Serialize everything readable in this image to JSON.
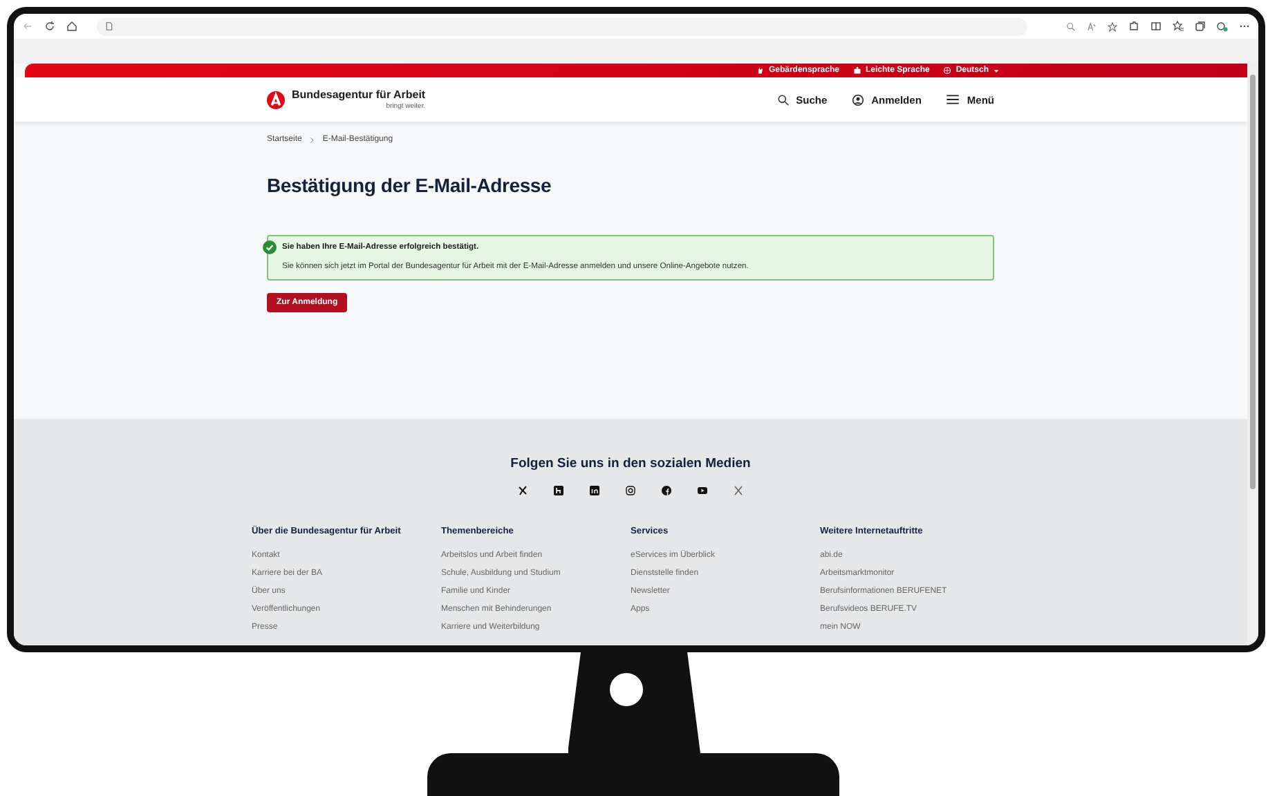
{
  "topbar": {
    "links": [
      {
        "label": "Gebärdensprache",
        "kind": "sign"
      },
      {
        "label": "Leichte Sprache",
        "kind": "easy"
      },
      {
        "label": "Deutsch",
        "kind": "language"
      }
    ]
  },
  "header": {
    "logo_name": "Bundesagentur für Arbeit",
    "logo_tagline": "bringt weiter.",
    "nav": [
      {
        "label": "Suche",
        "kind": "search"
      },
      {
        "label": "Anmelden",
        "kind": "account"
      },
      {
        "label": "Menü",
        "kind": "menu"
      }
    ]
  },
  "breadcrumb": [
    "Startseite",
    "E-Mail-Bestätigung"
  ],
  "title": "Bestätigung der E-Mail-Adresse",
  "alert": {
    "title": "Sie haben Ihre E-Mail-Adresse erfolgreich bestätigt.",
    "text": "Sie können sich jetzt im Portal der Bundesagentur für Arbeit mit der E-Mail-Adresse anmelden und unsere Online-Angebote nutzen."
  },
  "button": "Zur Anmeldung",
  "footer": {
    "social_heading": "Folgen Sie uns in den sozialen Medien",
    "columns": [
      {
        "heading": "Über die Bundesagentur für Arbeit",
        "links": [
          "Kontakt",
          "Karriere bei der BA",
          "Über uns",
          "Veröffentlichungen",
          "Presse"
        ]
      },
      {
        "heading": "Themenbereiche",
        "links": [
          "Arbeitslos und Arbeit finden",
          "Schule, Ausbildung und Studium",
          "Familie und Kinder",
          "Menschen mit Behinderungen",
          "Karriere und Weiterbildung"
        ]
      },
      {
        "heading": "Services",
        "links": [
          "eServices im Überblick",
          "Dienststelle finden",
          "Newsletter",
          "Apps"
        ]
      },
      {
        "heading": "Weitere Internetauftritte",
        "links": [
          "abi.de",
          "Arbeitsmarktmonitor",
          "Berufsinformationen BERUFENET",
          "Berufsvideos BERUFE.TV",
          "mein NOW"
        ]
      }
    ]
  }
}
